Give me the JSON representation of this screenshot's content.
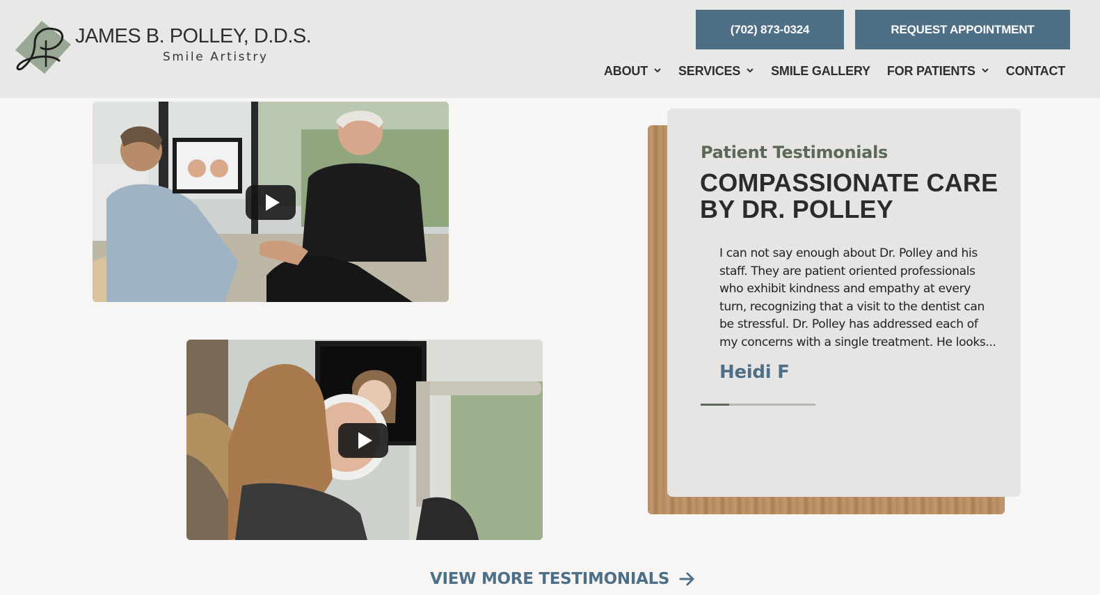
{
  "header": {
    "logo": {
      "name": "JAMES B. POLLEY, D.D.S.",
      "tagline": "Smile Artistry"
    },
    "phone_button": "(702) 873-0324",
    "appointment_button": "REQUEST APPOINTMENT",
    "nav": [
      {
        "label": "ABOUT",
        "has_dropdown": true
      },
      {
        "label": "SERVICES",
        "has_dropdown": true
      },
      {
        "label": "SMILE GALLERY",
        "has_dropdown": false
      },
      {
        "label": "FOR PATIENTS",
        "has_dropdown": true
      },
      {
        "label": "CONTACT",
        "has_dropdown": false
      }
    ]
  },
  "videos": [
    {
      "icon": "play-icon"
    },
    {
      "icon": "play-icon"
    }
  ],
  "testimonial": {
    "eyebrow": "Patient Testimonials",
    "title": "COMPASSIONATE CARE BY DR. POLLEY",
    "quote": "I can not say enough about Dr. Polley and his staff. They are patient oriented professionals who exhibit kindness and empathy at every turn, recognizing that a visit to the dentist can be stressful. Dr. Polley has addressed each of my concerns with a single treatment. He looks...",
    "author": "Heidi F",
    "progress": 0.25
  },
  "footer_link": {
    "label": "VIEW MORE TESTIMONIALS",
    "icon": "arrow-right-icon"
  },
  "colors": {
    "header_bg": "#e8e8e6",
    "page_bg": "#f7f6f5",
    "button_bg": "#4f6f86",
    "accent_green": "#5b6a58",
    "accent_blue": "#4d6f87",
    "card_bg": "#e6e5e3"
  }
}
